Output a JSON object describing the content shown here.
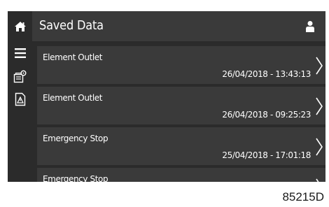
{
  "header": {
    "title": "Saved Data",
    "home_icon": "home-icon",
    "user_icon": "user-icon"
  },
  "sidebar": {
    "items": [
      {
        "icon": "menu-icon"
      },
      {
        "icon": "settings-document-icon"
      },
      {
        "icon": "warning-document-icon"
      }
    ]
  },
  "list": {
    "rows": [
      {
        "title": "Element Outlet",
        "date": "26/04/2018 - 13:43:13"
      },
      {
        "title": "Element Outlet",
        "date": "26/04/2018 - 09:25:23"
      },
      {
        "title": "Emergency Stop",
        "date": "25/04/2018 - 17:01:18"
      },
      {
        "title": "Emergency Stop",
        "date": ""
      }
    ]
  },
  "figure_id": "85215D",
  "colors": {
    "background": "#2b2b2b",
    "header": "#3a3a3a",
    "row": "#3a3a3a",
    "text": "#ffffff"
  }
}
